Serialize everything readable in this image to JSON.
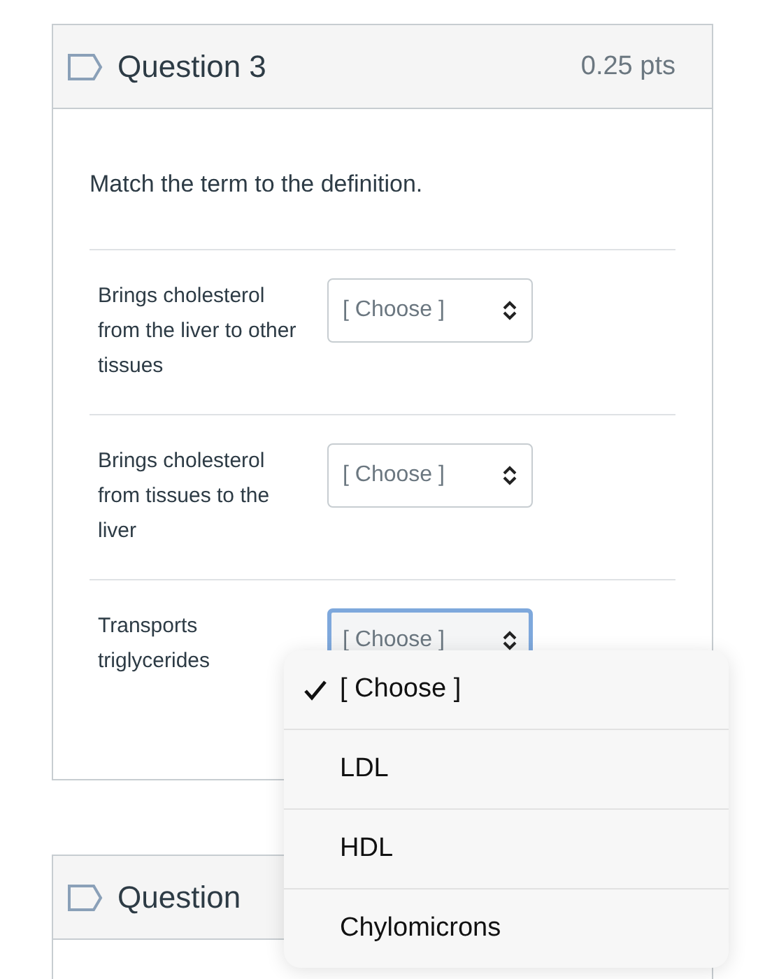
{
  "questions": [
    {
      "title": "Question 3",
      "points": "0.25 pts",
      "prompt": "Match the term to the definition.",
      "matches": [
        {
          "term": "Brings cholesterol from the liver to other tissues",
          "value": "[ Choose ]",
          "focused": false
        },
        {
          "term": "Brings cholesterol from tissues to the liver",
          "value": "[ Choose ]",
          "focused": false
        },
        {
          "term": "Transports triglycerides",
          "value": "[ Choose ]",
          "focused": true
        }
      ]
    },
    {
      "title": "Question"
    }
  ],
  "dropdown": {
    "options": [
      {
        "label": "[ Choose ]",
        "selected": true
      },
      {
        "label": "LDL",
        "selected": false
      },
      {
        "label": "HDL",
        "selected": false
      },
      {
        "label": "Chylomicrons",
        "selected": false
      }
    ]
  }
}
